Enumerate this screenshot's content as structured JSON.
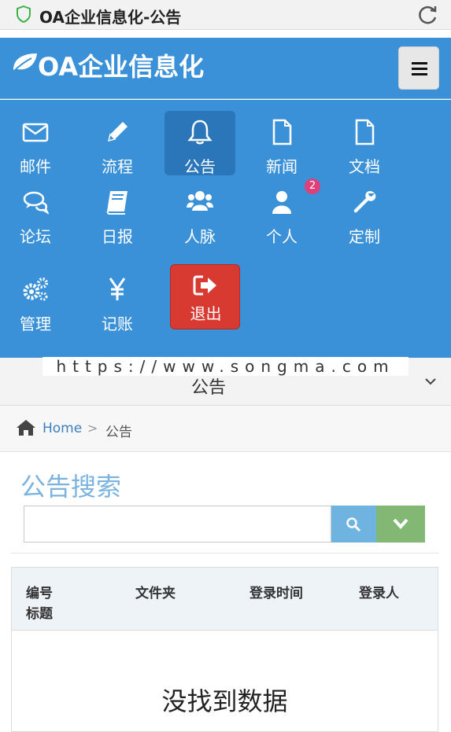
{
  "browser": {
    "title": "OA企业信息化-公告"
  },
  "header": {
    "logo_text": "OA企业信息化"
  },
  "nav": {
    "items": [
      {
        "label": "邮件",
        "icon": "envelope-icon"
      },
      {
        "label": "流程",
        "icon": "pencil-icon"
      },
      {
        "label": "公告",
        "icon": "bell-icon",
        "active": true
      },
      {
        "label": "新闻",
        "icon": "file-icon"
      },
      {
        "label": "文档",
        "icon": "file-icon"
      },
      {
        "label": "论坛",
        "icon": "comments-icon"
      },
      {
        "label": "日报",
        "icon": "book-icon"
      },
      {
        "label": "人脉",
        "icon": "users-icon"
      },
      {
        "label": "个人",
        "icon": "user-icon",
        "badge": "2"
      },
      {
        "label": "定制",
        "icon": "wrench-icon"
      },
      {
        "label": "管理",
        "icon": "gears-icon"
      },
      {
        "label": "记账",
        "icon": "yen-icon"
      }
    ],
    "logout_label": "退出"
  },
  "watermark": "https://www.songma.com",
  "section": {
    "title": "公告"
  },
  "breadcrumb": {
    "home": "Home",
    "separator": ">",
    "current": "公告"
  },
  "search": {
    "title": "公告搜索",
    "placeholder": ""
  },
  "table": {
    "columns": [
      "编号",
      "标题",
      "文件夹",
      "登录时间",
      "登录人"
    ],
    "empty_text": "没找到数据"
  },
  "colors": {
    "primary": "#3a91d8",
    "danger": "#d83a31",
    "search": "#6fb3e0",
    "success": "#82b874",
    "badge": "#e0407a"
  }
}
